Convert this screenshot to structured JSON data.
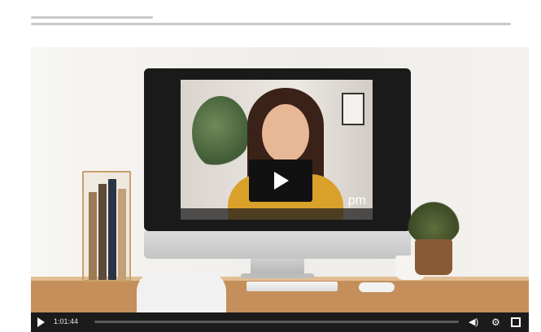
{
  "breadcrumb": {
    "text": ""
  },
  "player": {
    "screen_overlay_text": "pm",
    "timestamp": "1:01:44",
    "icons": {
      "play": "play-icon",
      "volume": "volume-icon",
      "settings": "gear-icon",
      "fullscreen": "fullscreen-icon"
    },
    "volume_glyph": "◀)",
    "settings_glyph": "⚙"
  }
}
